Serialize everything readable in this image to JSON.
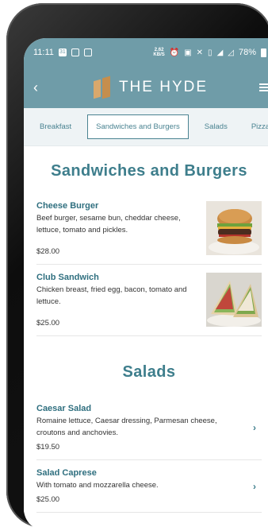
{
  "status_bar": {
    "time": "11:11",
    "left_icons": [
      "31",
      "square-icon",
      "square-icon"
    ],
    "speed_top": "2.62",
    "speed_bottom": "KB/S",
    "battery_percent": "78%"
  },
  "header": {
    "brand": "THE HYDE",
    "back_icon": "chevron-left-icon",
    "menu_icon": "menu-icon"
  },
  "tabs": [
    {
      "label": "Breakfast",
      "active": false
    },
    {
      "label": "Sandwiches and Burgers",
      "active": true
    },
    {
      "label": "Salads",
      "active": false
    },
    {
      "label": "Pizza",
      "active": false
    }
  ],
  "sections": {
    "sandwiches": {
      "title": "Sandwiches and Burgers",
      "items": [
        {
          "name": "Cheese Burger",
          "description": "Beef burger, sesame bun, cheddar cheese, lettuce, tomato and pickles.",
          "price": "$28.00"
        },
        {
          "name": "Club Sandwich",
          "description": "Chicken breast, fried egg, bacon, tomato and lettuce.",
          "price": "$25.00"
        }
      ]
    },
    "salads": {
      "title": "Salads",
      "items": [
        {
          "name": "Caesar Salad",
          "description": "Romaine lettuce, Caesar dressing, Parmesan cheese, croutons and anchovies.",
          "price": "$19.50"
        },
        {
          "name": "Salad Caprese",
          "description": "With tomato and mozzarella cheese.",
          "price": "$25.00"
        }
      ]
    }
  },
  "colors": {
    "header_bg": "#6f9ca8",
    "accent": "#3e7e8c",
    "logo_gold": "#c58e4d"
  }
}
